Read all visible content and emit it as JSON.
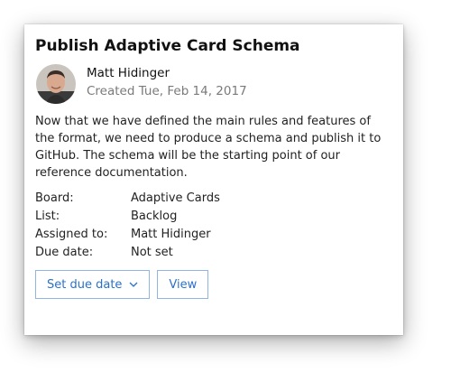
{
  "card": {
    "title": "Publish Adaptive Card Schema",
    "author": {
      "name": "Matt Hidinger",
      "created": "Created Tue, Feb 14, 2017",
      "avatar_icon": "person-avatar"
    },
    "description": "Now that we have defined the main rules and features of the format, we need to produce a schema and publish it to GitHub. The schema will be the starting point of our reference documentation.",
    "facts": [
      {
        "label": "Board:",
        "value": "Adaptive Cards"
      },
      {
        "label": "List:",
        "value": "Backlog"
      },
      {
        "label": "Assigned to:",
        "value": "Matt Hidinger"
      },
      {
        "label": "Due date:",
        "value": "Not set"
      }
    ],
    "actions": {
      "set_due_date": "Set due date",
      "view": "View"
    }
  },
  "colors": {
    "accent": "#2a71c9",
    "button_border": "#8fb5e0",
    "muted_text": "#7a7a7a"
  }
}
